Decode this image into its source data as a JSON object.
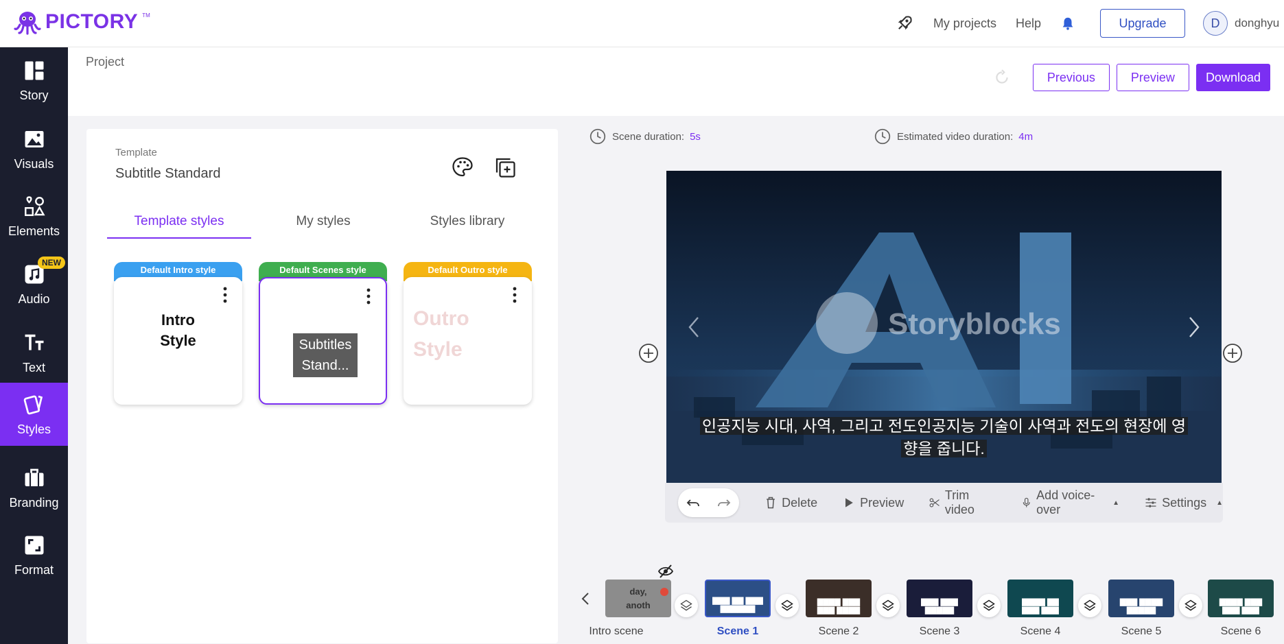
{
  "header": {
    "logo_text": "PICTORY",
    "logo_tm": "TM",
    "nav": {
      "my_projects": "My projects",
      "help": "Help",
      "upgrade": "Upgrade",
      "avatar_initial": "D",
      "username": "donghyu"
    }
  },
  "sidebar": {
    "items": [
      {
        "label": "Story",
        "icon": "story-icon"
      },
      {
        "label": "Visuals",
        "icon": "image-icon"
      },
      {
        "label": "Elements",
        "icon": "shapes-icon"
      },
      {
        "label": "Audio",
        "icon": "music-icon",
        "badge": "NEW"
      },
      {
        "label": "Text",
        "icon": "text-icon"
      },
      {
        "label": "Styles",
        "icon": "styles-icon",
        "active": true
      },
      {
        "label": "Branding",
        "icon": "briefcase-icon"
      },
      {
        "label": "Format",
        "icon": "format-icon"
      }
    ]
  },
  "project_bar": {
    "title": "Project",
    "previous": "Previous",
    "preview": "Preview",
    "download": "Download"
  },
  "panel": {
    "template_label": "Template",
    "template_name": "Subtitle Standard",
    "tabs": [
      "Template styles",
      "My styles",
      "Styles library"
    ],
    "active_tab": 0,
    "cards": [
      {
        "tag": "Default Intro style",
        "tag_color": "#3aa0f0",
        "text_line1": "Intro",
        "text_line2": "Style"
      },
      {
        "tag": "Default Scenes style",
        "tag_color": "#3fae4f",
        "text_line1": "Subtitles",
        "text_line2": "Stand..."
      },
      {
        "tag": "Default Outro style",
        "tag_color": "#f5b512",
        "text_line1": "Outro",
        "text_line2": "Style"
      }
    ]
  },
  "durations": {
    "scene_label": "Scene duration:",
    "scene_value": "5s",
    "estimated_label": "Estimated video duration:",
    "estimated_value": "4m"
  },
  "video": {
    "watermark": "Storyblocks",
    "subtitle_line1": "인공지능 시대, 사역, 그리고 전도인공지능 기술이 사역과 전도의 현장에 영",
    "subtitle_line2": "향을 줍니다."
  },
  "toolbar": {
    "delete": "Delete",
    "preview": "Preview",
    "trim": "Trim video",
    "voiceover": "Add voice-over",
    "settings": "Settings"
  },
  "timeline": {
    "scenes": [
      {
        "label": "Intro scene",
        "text": "day,\nanoth"
      },
      {
        "label": "Scene 1",
        "active": true
      },
      {
        "label": "Scene 2"
      },
      {
        "label": "Scene 3"
      },
      {
        "label": "Scene 4"
      },
      {
        "label": "Scene 5"
      },
      {
        "label": "Scene 6"
      }
    ]
  },
  "colors": {
    "accent": "#7b2ff2",
    "sidebar_bg": "#1b1e2e",
    "upgrade_blue": "#2f4fc2"
  }
}
